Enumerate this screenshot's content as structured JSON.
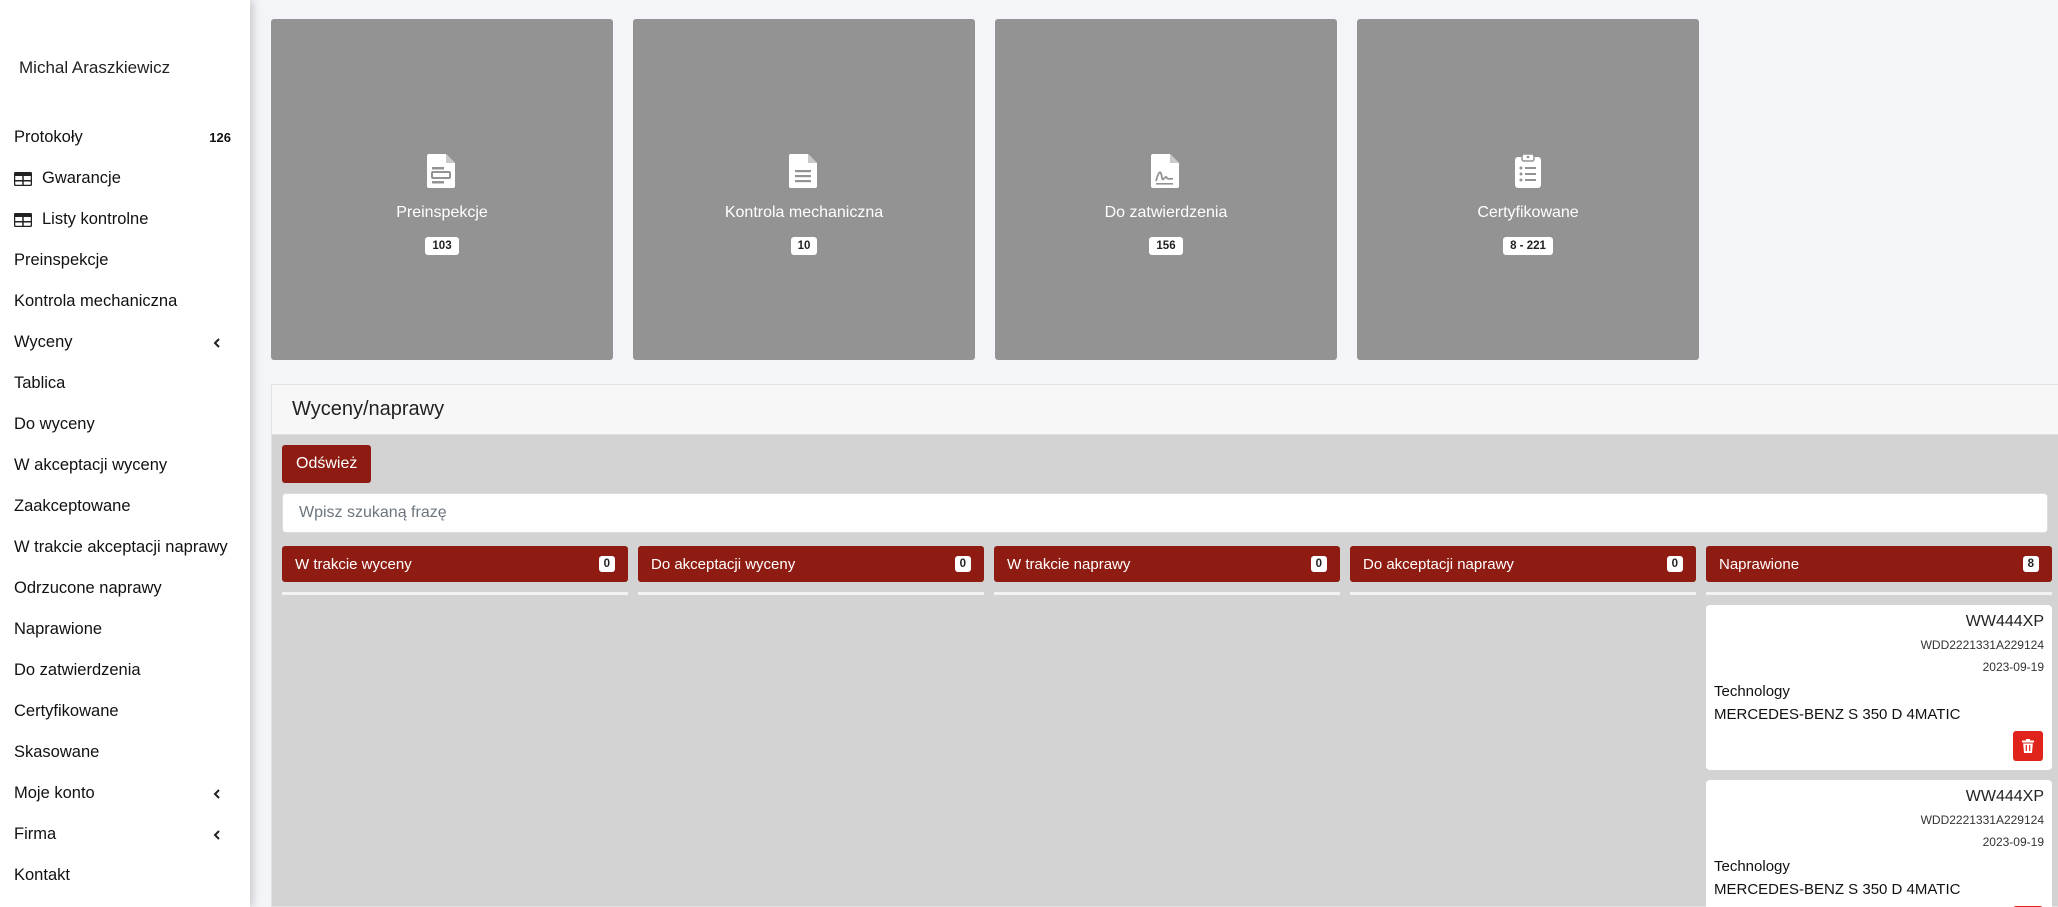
{
  "user": {
    "name": "Michal Araszkiewicz"
  },
  "sidebar": {
    "items": [
      {
        "label": "Protokoły",
        "badge": "126"
      },
      {
        "label": "Gwarancje",
        "icon": "table-icon"
      },
      {
        "label": "Listy kontrolne",
        "icon": "table-icon"
      },
      {
        "label": "Preinspekcje"
      },
      {
        "label": "Kontrola mechaniczna"
      },
      {
        "label": "Wyceny",
        "chevron": "chevron-left-icon"
      },
      {
        "label": "Tablica"
      },
      {
        "label": "Do wyceny"
      },
      {
        "label": "W akceptacji wyceny"
      },
      {
        "label": "Zaakceptowane"
      },
      {
        "label": "W trakcie akceptacji naprawy"
      },
      {
        "label": "Odrzucone naprawy"
      },
      {
        "label": "Naprawione"
      },
      {
        "label": "Do zatwierdzenia"
      },
      {
        "label": "Certyfikowane"
      },
      {
        "label": "Skasowane"
      },
      {
        "label": "Moje konto",
        "chevron": "chevron-left-icon"
      },
      {
        "label": "Firma",
        "chevron": "chevron-left-icon"
      },
      {
        "label": "Kontakt"
      }
    ]
  },
  "tiles": [
    {
      "title": "Preinspekcje",
      "count": "103",
      "icon": "document-form-icon"
    },
    {
      "title": "Kontrola mechaniczna",
      "count": "10",
      "icon": "document-text-icon"
    },
    {
      "title": "Do zatwierdzenia",
      "count": "156",
      "icon": "document-signature-icon"
    },
    {
      "title": "Certyfikowane",
      "count": "8 - 221",
      "icon": "clipboard-list-icon"
    }
  ],
  "panel": {
    "title": "Wyceny/naprawy",
    "refresh_label": "Odśwież",
    "search_placeholder": "Wpisz szukaną frazę"
  },
  "columns": [
    {
      "title": "W trakcie wyceny",
      "count": "0"
    },
    {
      "title": "Do akceptacji wyceny",
      "count": "0"
    },
    {
      "title": "W trakcie naprawy",
      "count": "0"
    },
    {
      "title": "Do akceptacji naprawy",
      "count": "0"
    },
    {
      "title": "Naprawione",
      "count": "8"
    }
  ],
  "cards": [
    {
      "plate": "WW444XP",
      "vin": "WDD2221331A229124",
      "date": "2023-09-19",
      "company": "Technology",
      "model": "MERCEDES-BENZ S 350 D 4MATIC"
    },
    {
      "plate": "WW444XP",
      "vin": "WDD2221331A229124",
      "date": "2023-09-19",
      "company": "Technology",
      "model": "MERCEDES-BENZ S 350 D 4MATIC"
    }
  ],
  "colors": {
    "accent": "#8f1c12",
    "delete": "#e0241c",
    "tile": "#939393",
    "board": "#d3d3d3"
  }
}
